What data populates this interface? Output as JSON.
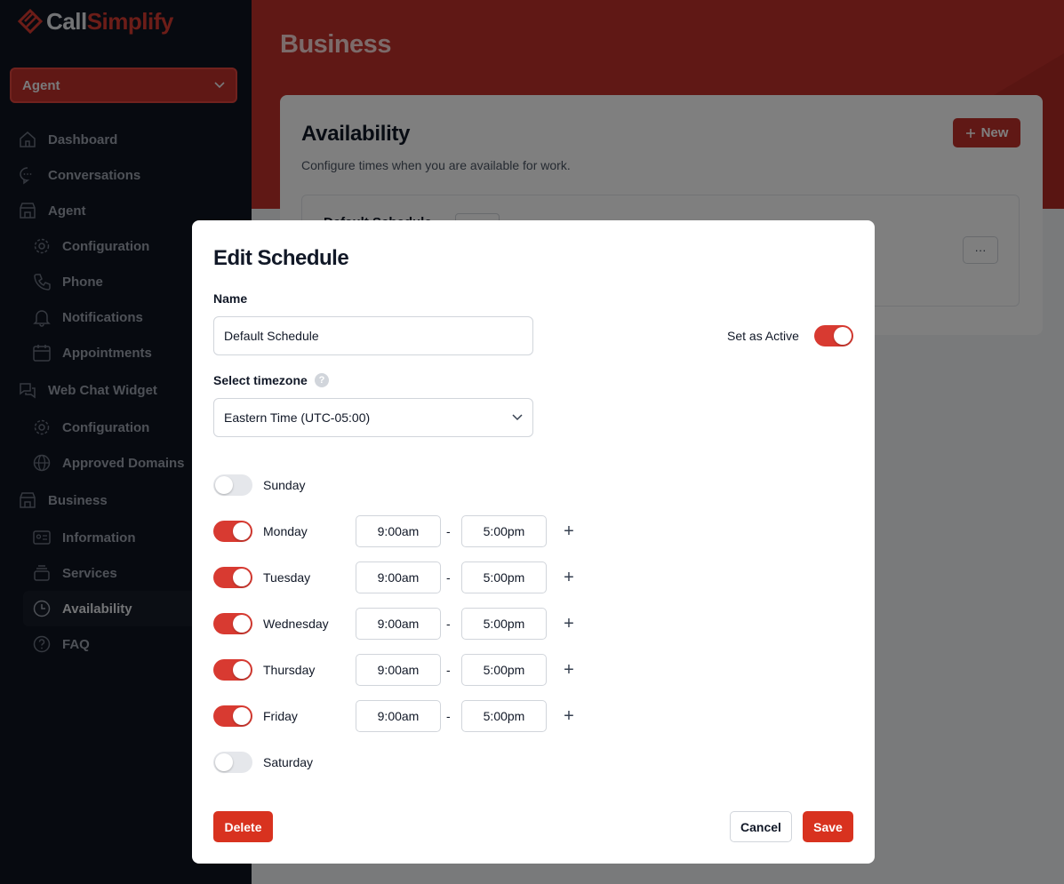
{
  "brand": {
    "name_part1": "Call",
    "name_part2": "Simplify",
    "accent": "#d83a31"
  },
  "role_select": {
    "value": "Agent"
  },
  "sidebar": {
    "items": [
      {
        "label": "Dashboard",
        "icon": "home-icon"
      },
      {
        "label": "Conversations",
        "icon": "chat-bubble-icon"
      },
      {
        "label": "Agent",
        "icon": "storefront-icon"
      },
      {
        "label": "Configuration",
        "icon": "gear-icon"
      },
      {
        "label": "Phone",
        "icon": "phone-icon"
      },
      {
        "label": "Notifications",
        "icon": "bell-icon"
      },
      {
        "label": "Appointments",
        "icon": "calendar-icon"
      },
      {
        "label": "Web Chat Widget",
        "icon": "chat-bubbles-icon"
      },
      {
        "label": "Configuration",
        "icon": "gear-icon"
      },
      {
        "label": "Approved Domains",
        "icon": "globe-icon"
      },
      {
        "label": "Business",
        "icon": "storefront-icon"
      },
      {
        "label": "Information",
        "icon": "id-card-icon"
      },
      {
        "label": "Services",
        "icon": "stack-icon"
      },
      {
        "label": "Availability",
        "icon": "clock-icon"
      },
      {
        "label": "FAQ",
        "icon": "question-circle-icon"
      }
    ],
    "active": "Availability"
  },
  "page": {
    "title": "Business"
  },
  "card": {
    "title": "Availability",
    "subtitle": "Configure times when you are available for work.",
    "new_button": "New",
    "more_button": "···"
  },
  "modal": {
    "title": "Edit Schedule",
    "name_label": "Name",
    "name_value": "Default Schedule",
    "active_label": "Set as Active",
    "active_on": true,
    "timezone_label": "Select timezone",
    "timezone_value": "Eastern Time (UTC-05:00)",
    "days": [
      {
        "name": "Sunday",
        "enabled": false
      },
      {
        "name": "Monday",
        "enabled": true,
        "start": "9:00am",
        "end": "5:00pm"
      },
      {
        "name": "Tuesday",
        "enabled": true,
        "start": "9:00am",
        "end": "5:00pm"
      },
      {
        "name": "Wednesday",
        "enabled": true,
        "start": "9:00am",
        "end": "5:00pm"
      },
      {
        "name": "Thursday",
        "enabled": true,
        "start": "9:00am",
        "end": "5:00pm"
      },
      {
        "name": "Friday",
        "enabled": true,
        "start": "9:00am",
        "end": "5:00pm"
      },
      {
        "name": "Saturday",
        "enabled": false
      }
    ],
    "range_separator": "-",
    "delete_button": "Delete",
    "cancel_button": "Cancel",
    "save_button": "Save"
  }
}
